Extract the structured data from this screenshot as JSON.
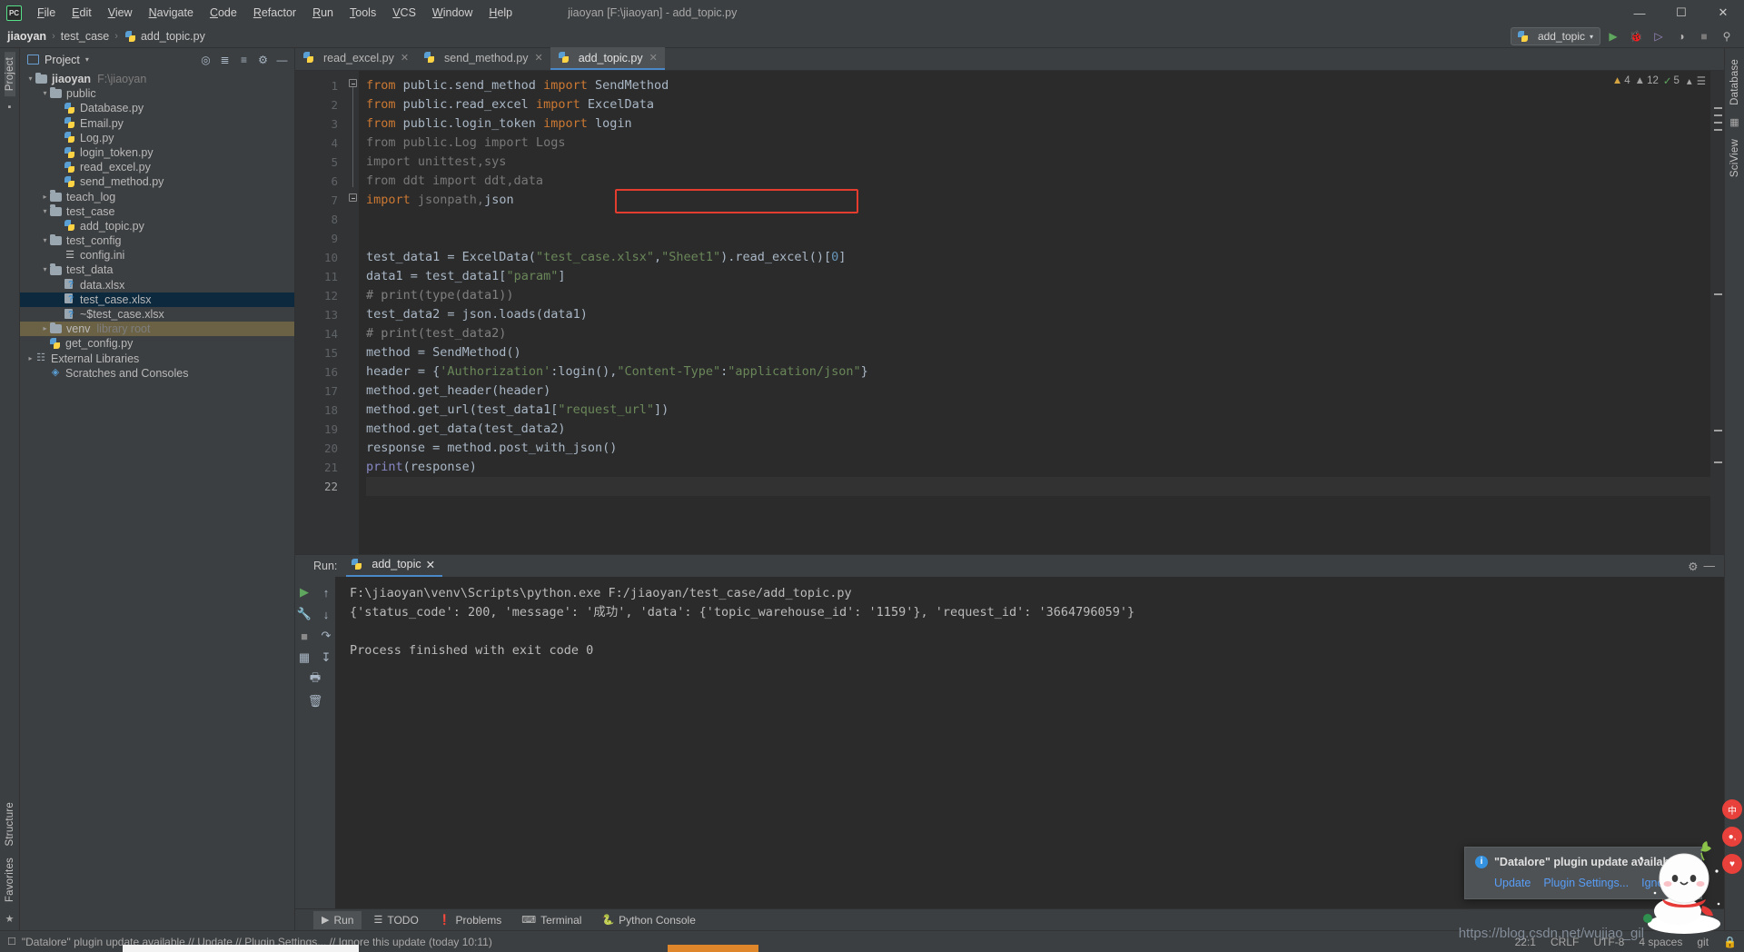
{
  "window": {
    "title": "jiaoyan [F:\\jiaoyan] - add_topic.py",
    "logo": "PC",
    "controls": {
      "minimize": "—",
      "maximize": "☐",
      "close": "✕"
    }
  },
  "menu": {
    "items": [
      "File",
      "Edit",
      "View",
      "Navigate",
      "Code",
      "Refactor",
      "Run",
      "Tools",
      "VCS",
      "Window",
      "Help"
    ]
  },
  "breadcrumb": {
    "items": [
      "jiaoyan",
      "test_case",
      "add_topic.py"
    ],
    "separator": "›"
  },
  "toolbar": {
    "run_config": "add_topic",
    "run_label": "▶",
    "debug_label": "🐞",
    "coverage_label": "▶",
    "profile_label": "◷",
    "stop_label": "■",
    "search_label": "⌕"
  },
  "left_rail": {
    "project_tab": "Project",
    "structure_tab": "Structure",
    "favorites_tab": "Favorites"
  },
  "right_rail": {
    "database_tab": "Database",
    "sciview_tab": "SciView"
  },
  "project_panel": {
    "title": "Project",
    "dropdown": "▾",
    "actions": [
      "locate-icon",
      "collapse-all-icon",
      "expand-icon",
      "settings-icon",
      "hide-icon"
    ],
    "tree": [
      {
        "label": "jiaoyan",
        "secondary": "F:\\jiaoyan",
        "icon": "folder",
        "arrow": "down",
        "indent": 1,
        "bold": true,
        "state": "normal"
      },
      {
        "label": "public",
        "icon": "folder",
        "arrow": "down",
        "indent": 2,
        "state": "normal"
      },
      {
        "label": "Database.py",
        "icon": "python",
        "arrow": "none",
        "indent": 3,
        "state": "normal"
      },
      {
        "label": "Email.py",
        "icon": "python",
        "arrow": "none",
        "indent": 3,
        "state": "normal"
      },
      {
        "label": "Log.py",
        "icon": "python",
        "arrow": "none",
        "indent": 3,
        "state": "normal"
      },
      {
        "label": "login_token.py",
        "icon": "python",
        "arrow": "none",
        "indent": 3,
        "state": "normal"
      },
      {
        "label": "read_excel.py",
        "icon": "python",
        "arrow": "none",
        "indent": 3,
        "state": "normal"
      },
      {
        "label": "send_method.py",
        "icon": "python",
        "arrow": "none",
        "indent": 3,
        "state": "normal"
      },
      {
        "label": "teach_log",
        "icon": "folder",
        "arrow": "right",
        "indent": 2,
        "state": "normal"
      },
      {
        "label": "test_case",
        "icon": "folder",
        "arrow": "down",
        "indent": 2,
        "state": "normal"
      },
      {
        "label": "add_topic.py",
        "icon": "python",
        "arrow": "none",
        "indent": 3,
        "state": "normal"
      },
      {
        "label": "test_config",
        "icon": "folder",
        "arrow": "down",
        "indent": 2,
        "state": "normal"
      },
      {
        "label": "config.ini",
        "icon": "ini",
        "arrow": "none",
        "indent": 3,
        "state": "normal"
      },
      {
        "label": "test_data",
        "icon": "folder",
        "arrow": "down",
        "indent": 2,
        "state": "normal"
      },
      {
        "label": "data.xlsx",
        "icon": "xlsx",
        "arrow": "none",
        "indent": 3,
        "state": "normal"
      },
      {
        "label": "test_case.xlsx",
        "icon": "xlsx",
        "arrow": "none",
        "indent": 3,
        "state": "selected"
      },
      {
        "label": "~$test_case.xlsx",
        "icon": "xlsx",
        "arrow": "none",
        "indent": 3,
        "state": "normal"
      },
      {
        "label": "venv",
        "secondary": "library root",
        "icon": "folder",
        "arrow": "right",
        "indent": 2,
        "state": "highlight"
      },
      {
        "label": "get_config.py",
        "icon": "python",
        "arrow": "none",
        "indent": 2,
        "state": "normal"
      },
      {
        "label": "External Libraries",
        "icon": "libs",
        "arrow": "right",
        "indent": 1,
        "state": "normal"
      },
      {
        "label": "Scratches and Consoles",
        "icon": "scratch",
        "arrow": "none",
        "indent": 1,
        "state": "normal"
      }
    ]
  },
  "editor": {
    "tabs": [
      {
        "label": "read_excel.py",
        "icon": "python-file-icon",
        "active": false
      },
      {
        "label": "send_method.py",
        "icon": "python-file-icon",
        "active": false
      },
      {
        "label": "add_topic.py",
        "icon": "python-file-icon",
        "active": true
      }
    ],
    "inspections": {
      "warnings": "4",
      "weak_warnings": "12",
      "ok": "5"
    },
    "line_numbers": [
      "1",
      "2",
      "3",
      "4",
      "5",
      "6",
      "7",
      "8",
      "9",
      "10",
      "11",
      "12",
      "13",
      "14",
      "15",
      "16",
      "17",
      "18",
      "19",
      "20",
      "21",
      "22"
    ],
    "lines": [
      {
        "n": 1,
        "tokens": [
          [
            "kw",
            "from "
          ],
          [
            "cls",
            "public.send_method "
          ],
          [
            "kw",
            "import "
          ],
          [
            "cls",
            "SendMethod"
          ]
        ]
      },
      {
        "n": 2,
        "tokens": [
          [
            "kw",
            "from "
          ],
          [
            "cls",
            "public.read_excel "
          ],
          [
            "kw",
            "import "
          ],
          [
            "cls",
            "ExcelData"
          ]
        ]
      },
      {
        "n": 3,
        "tokens": [
          [
            "kw",
            "from "
          ],
          [
            "cls",
            "public.login_token "
          ],
          [
            "kw",
            "import "
          ],
          [
            "cls",
            "login"
          ]
        ]
      },
      {
        "n": 4,
        "tokens": [
          [
            "dim-import",
            "from public.Log import Logs"
          ]
        ]
      },
      {
        "n": 5,
        "tokens": [
          [
            "dim-import",
            "import unittest,sys"
          ]
        ]
      },
      {
        "n": 6,
        "tokens": [
          [
            "dim-import",
            "from ddt import ddt,data"
          ]
        ]
      },
      {
        "n": 7,
        "tokens": [
          [
            "kw",
            "import "
          ],
          [
            "dim-import",
            "jsonpath,"
          ],
          [
            "cls",
            "json"
          ]
        ]
      },
      {
        "n": 8,
        "tokens": [
          [
            "cls",
            ""
          ]
        ]
      },
      {
        "n": 9,
        "tokens": [
          [
            "cls",
            ""
          ]
        ]
      },
      {
        "n": 10,
        "tokens": [
          [
            "cls",
            "test_data1 = ExcelData("
          ],
          [
            "str",
            "\"test_case.xlsx\""
          ],
          [
            "cls",
            ","
          ],
          [
            "str",
            "\"Sheet1\""
          ],
          [
            "cls",
            ").read_excel()["
          ],
          [
            "num",
            "0"
          ],
          [
            "cls",
            "]"
          ]
        ]
      },
      {
        "n": 11,
        "tokens": [
          [
            "cls",
            "data1 = test_data1["
          ],
          [
            "str",
            "\"param\""
          ],
          [
            "cls",
            "]"
          ]
        ]
      },
      {
        "n": 12,
        "tokens": [
          [
            "cmt",
            "# print(type(data1))"
          ]
        ]
      },
      {
        "n": 13,
        "tokens": [
          [
            "cls",
            "test_data2 = json.loads(data1)"
          ]
        ],
        "highlighted": true
      },
      {
        "n": 14,
        "tokens": [
          [
            "cmt",
            "# print(test_data2)"
          ]
        ]
      },
      {
        "n": 15,
        "tokens": [
          [
            "cls",
            "method = SendMethod()"
          ]
        ]
      },
      {
        "n": 16,
        "tokens": [
          [
            "cls",
            "header = {"
          ],
          [
            "str",
            "'Authorization'"
          ],
          [
            "cls",
            ":login(),"
          ],
          [
            "str",
            "\"Content-Type\""
          ],
          [
            "cls",
            ":"
          ],
          [
            "str",
            "\"application/json\""
          ],
          [
            "cls",
            "}"
          ]
        ]
      },
      {
        "n": 17,
        "tokens": [
          [
            "cls",
            "method.get_header(header)"
          ]
        ]
      },
      {
        "n": 18,
        "tokens": [
          [
            "cls",
            "method.get_url(test_data1["
          ],
          [
            "str",
            "\"request_url\""
          ],
          [
            "cls",
            "])"
          ]
        ]
      },
      {
        "n": 19,
        "tokens": [
          [
            "cls",
            "method.get_data(test_data2)"
          ]
        ]
      },
      {
        "n": 20,
        "tokens": [
          [
            "cls",
            "response = method.post_with_json()"
          ]
        ]
      },
      {
        "n": 21,
        "tokens": [
          [
            "fn",
            "print"
          ],
          [
            "cls",
            "(response)"
          ]
        ]
      },
      {
        "n": 22,
        "tokens": [
          [
            "cls",
            ""
          ]
        ],
        "current": true
      }
    ]
  },
  "run_window": {
    "label": "Run:",
    "tab": "add_topic",
    "console_lines": [
      "F:\\jiaoyan\\venv\\Scripts\\python.exe F:/jiaoyan/test_case/add_topic.py",
      "{'status_code': 200, 'message': '成功', 'data': {'topic_warehouse_id': '1159'}, 'request_id': '3664796059'}",
      "",
      "Process finished with exit code 0"
    ],
    "rail_icons": [
      "run-icon",
      "rerun-icon",
      "stop-icon",
      "pin-icon",
      "trash-icon",
      "up-icon",
      "down-icon",
      "wrap-icon",
      "scroll-end-icon",
      "print-icon"
    ],
    "settings_icon": "gear-icon",
    "hide_icon": "minimize-icon"
  },
  "bottom_strip": {
    "items": [
      {
        "label": "Run",
        "icon": "run-icon",
        "active": true
      },
      {
        "label": "TODO",
        "icon": "todo-icon",
        "active": false
      },
      {
        "label": "Problems",
        "icon": "problems-icon",
        "active": false
      },
      {
        "label": "Terminal",
        "icon": "terminal-icon",
        "active": false
      },
      {
        "label": "Python Console",
        "icon": "python-console-icon",
        "active": false
      }
    ]
  },
  "status_bar": {
    "message": "\"Datalore\" plugin update available // Update // Plugin Settings... // Ignore this update (today 10:11)",
    "caret": "22:1",
    "line_sep": "CRLF",
    "encoding": "UTF-8",
    "indent": "4 spaces",
    "branch": "git"
  },
  "notification": {
    "title": "\"Datalore\" plugin update available",
    "links": [
      "Update",
      "Plugin Settings...",
      "Ignore thi"
    ],
    "info_icon": "info-icon"
  },
  "watermark": "https://blog.csdn.net/wujiao_gil",
  "right_float_buttons": [
    "中",
    "●•",
    "♥"
  ],
  "colors": {
    "accent": "#4a88c7",
    "editor_bg": "#2b2b2b",
    "panel_bg": "#3c3f41",
    "gutter_bg": "#313335",
    "selection": "#0d293e",
    "highlight_row": "#6b6246",
    "redbox": "#e43d30",
    "keyword": "#cc7832",
    "string": "#6a8759",
    "number": "#6897bb",
    "comment": "#808080",
    "link": "#589df6"
  }
}
